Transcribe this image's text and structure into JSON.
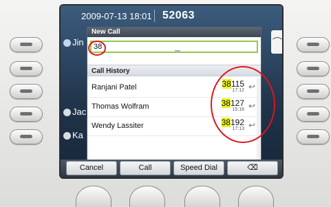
{
  "status_bar": {
    "datetime": "2009-07-13 18:01",
    "extension": "52063"
  },
  "lines": [
    {
      "label": "Jin",
      "icon": "phone-line-icon"
    },
    {
      "label": "Jac",
      "icon": "contact-icon"
    },
    {
      "label": "Ka",
      "icon": "contact-icon"
    }
  ],
  "dialog": {
    "title": "New Call",
    "input_value": "38",
    "history_header": "Call History",
    "history": [
      {
        "name": "Ranjani Patel",
        "number_match": "38",
        "number_rest": "115",
        "time": "17:12"
      },
      {
        "name": "Thomas Wolfram",
        "number_match": "38",
        "number_rest": "127",
        "time": "15:16"
      },
      {
        "name": "Wendy Lassiter",
        "number_match": "38",
        "number_rest": "192",
        "time": "17:13"
      }
    ]
  },
  "softkeys": [
    {
      "label": "Cancel"
    },
    {
      "label": "Call"
    },
    {
      "label": "Speed Dial"
    },
    {
      "label": "⌫",
      "icon": "backspace-icon"
    }
  ],
  "colors": {
    "highlight": "#e9f31a",
    "focus_border": "#93c64a",
    "annotation": "#e0141c"
  }
}
